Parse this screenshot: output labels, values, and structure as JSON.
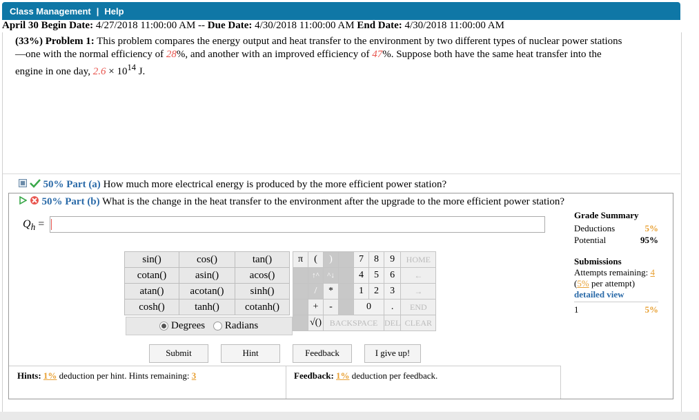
{
  "menu": {
    "class_management": "Class Management",
    "separator": "|",
    "help": "Help"
  },
  "dates": {
    "day": "April 30",
    "begin_label": "Begin Date:",
    "begin_value": "4/27/2018 11:00:00 AM",
    "dash": "--",
    "due_label": "Due Date:",
    "due_value": "4/30/2018 11:00:00 AM",
    "end_label": "End Date:",
    "end_value": "4/30/2018 11:00:00 AM"
  },
  "problem": {
    "heading": "(33%) Problem 1:",
    "text1": "This problem compares the energy output and heat transfer to the environment by two different types of nuclear power stations—one with the normal efficiency of",
    "eff1": "28",
    "text2": "%, and another with an improved efficiency of",
    "eff2": "47",
    "text3": "%. Suppose both have the same heat transfer into the engine in one day,",
    "value": "2.6",
    "times": "×",
    "base": "10",
    "exp": "14",
    "unit": "J."
  },
  "part_a": {
    "label": "50% Part (a)",
    "question": "How much more electrical energy is produced by the more efficient power station?"
  },
  "part_b": {
    "label": "50% Part (b)",
    "question": "What is the change in the heat transfer to the environment after the upgrade to the more efficient power station?"
  },
  "answer": {
    "label_q": "Q",
    "label_sub": "h",
    "eq": "=",
    "value": ""
  },
  "grade_summary": {
    "title": "Grade Summary",
    "deductions_label": "Deductions",
    "deductions_value": "5%",
    "potential_label": "Potential",
    "potential_value": "95%"
  },
  "submissions": {
    "title": "Submissions",
    "attempts_label": "Attempts remaining:",
    "attempts_value": "4",
    "per_attempt_value": "5%",
    "per_attempt_label": "per attempt)",
    "open_paren": "(",
    "detailed_view": "detailed view",
    "row_num": "1",
    "row_pct": "5%"
  },
  "keypad": {
    "functions": [
      [
        "sin()",
        "cos()",
        "tan()"
      ],
      [
        "cotan()",
        "asin()",
        "acos()"
      ],
      [
        "atan()",
        "acotan()",
        "sinh()"
      ],
      [
        "cosh()",
        "tanh()",
        "cotanh()"
      ]
    ],
    "degrees": "Degrees",
    "radians": "Radians",
    "mode_selected": "Degrees",
    "pi": "π",
    "lparen": "(",
    "rparen": ")",
    "up": "↑^",
    "down": "^↓",
    "slash": "/",
    "star": "*",
    "plus": "+",
    "minus": "-",
    "sqrt": "√()",
    "backspace": "BACKSPACE",
    "del": "DEL",
    "clear": "CLEAR",
    "home": "HOME",
    "left": "←",
    "right": "→",
    "end": "END",
    "dot": ".",
    "digits": [
      "7",
      "8",
      "9",
      "4",
      "5",
      "6",
      "1",
      "2",
      "3",
      "0"
    ]
  },
  "buttons": {
    "submit": "Submit",
    "hint": "Hint",
    "feedback": "Feedback",
    "give_up": "I give up!"
  },
  "hints": {
    "label": "Hints:",
    "pct": "1%",
    "text": "deduction per hint. Hints remaining:",
    "remaining": "3"
  },
  "feedback": {
    "label": "Feedback:",
    "pct": "1%",
    "text": "deduction per feedback."
  },
  "colors": {
    "topbar": "#0f77a6",
    "accent_red": "#e8554e",
    "link_blue": "#2a6aa8",
    "orange": "#e8a033"
  }
}
